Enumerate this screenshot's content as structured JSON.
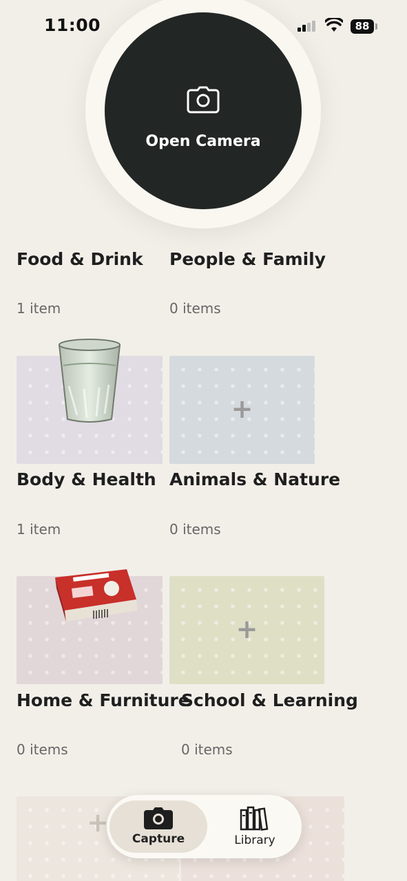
{
  "status": {
    "time": "11:00",
    "battery": "88"
  },
  "camera": {
    "label": "Open Camera",
    "icon": "camera-icon"
  },
  "categories": [
    {
      "title": "Food & Drink",
      "count": "1 item",
      "color": "#e1dbe3",
      "thumb": "glass-of-water"
    },
    {
      "title": "People & Family",
      "count": "0 items",
      "color": "#d5dade"
    },
    {
      "title": "Body & Health",
      "count": "1 item",
      "color": "#e1d6d8",
      "thumb": "medicine-box"
    },
    {
      "title": "Animals & Nature",
      "count": "0 items",
      "color": "#dfdfc6"
    },
    {
      "title": "Home & Furniture",
      "count": "0 items",
      "color": "#ece6de"
    },
    {
      "title": "School & Learning",
      "count": "0 items",
      "color": "#ebe0da"
    }
  ],
  "tabbar": {
    "capture": "Capture",
    "library": "Library"
  }
}
